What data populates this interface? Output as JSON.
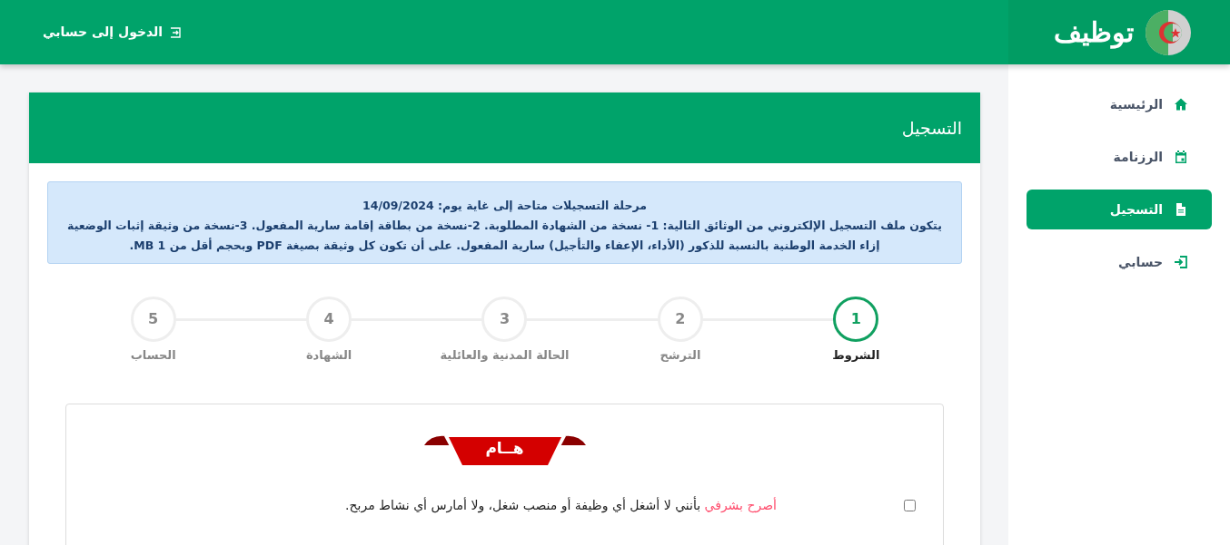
{
  "header": {
    "logo_text": "توظيف",
    "login_link": "الدخول إلى حسابي"
  },
  "sidebar": {
    "items": [
      {
        "kind": "home",
        "label": "الرئيسية",
        "selected": false
      },
      {
        "kind": "calendar",
        "label": "الرزنامة",
        "selected": false
      },
      {
        "kind": "document",
        "label": "التسجيل",
        "selected": true
      },
      {
        "kind": "login",
        "label": "حسابي",
        "selected": false
      }
    ]
  },
  "card": {
    "title": "التسجيل",
    "alert": {
      "heading": "مرحلة التسجيلات متاحة إلى غاية يوم: 14/09/2024",
      "body": "يتكون ملف التسجيل الإلكتروني من الوثائق التالية: 1- نسخة من الشهادة المطلوبة. 2-نسخة من بطاقة إقامة سارية المفعول. 3-نسخة من وثيقة إثبات الوضعية إزاء الخدمة الوطنية بالنسبة للذكور (الأداء، الإعفاء والتأجيل) سارية المفعول. على أن تكون كل وثيقة بصيغة PDF وبحجم أقل من 1 MB."
    },
    "steps": [
      {
        "number": "1",
        "label": "الشروط",
        "selected": true
      },
      {
        "number": "2",
        "label": "الترشح",
        "selected": false
      },
      {
        "number": "3",
        "label": "الحالة المدنية والعائلية",
        "selected": false
      },
      {
        "number": "4",
        "label": "الشهادة",
        "selected": false
      },
      {
        "number": "5",
        "label": "الحساب",
        "selected": false
      }
    ],
    "notice": {
      "ribbon": "هــام",
      "declaration": {
        "checked": false,
        "lead": "أصرح بشرفي",
        "text": " بأنني لا أشغل أي وظيفة أو منصب شغل، ولا أمارس أي نشاط مربح."
      }
    }
  }
}
